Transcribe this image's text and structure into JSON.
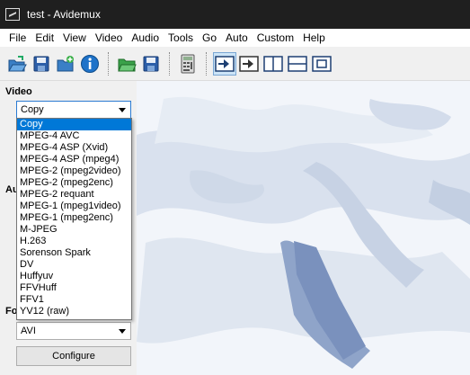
{
  "window": {
    "title": "test - Avidemux",
    "app_icon": "avidemux-app-icon"
  },
  "menubar": {
    "items": [
      "File",
      "Edit",
      "View",
      "Video",
      "Audio",
      "Tools",
      "Go",
      "Auto",
      "Custom",
      "Help"
    ]
  },
  "toolbar": {
    "icons": [
      "open-file-icon",
      "save-file-icon",
      "append-file-icon",
      "info-icon",
      "open-folder-icon",
      "save-project-icon",
      "calculator-icon",
      "play-filtered-icon",
      "next-keyframe-icon",
      "split-view-icon",
      "horizontal-view-icon",
      "fullscreen-icon"
    ]
  },
  "left_panel": {
    "video_label": "Video",
    "video_codec_value": "Copy",
    "audio_label_partial": "Au",
    "format_label_partial": "Fo",
    "format_value": "AVI",
    "configure_label": "Configure"
  },
  "video_codec_dropdown": {
    "options": [
      "Copy",
      "MPEG-4 AVC",
      "MPEG-4 ASP (Xvid)",
      "MPEG-4 ASP (mpeg4)",
      "MPEG-2 (mpeg2video)",
      "MPEG-2 (mpeg2enc)",
      "MPEG-2 requant",
      "MPEG-1 (mpeg1video)",
      "MPEG-1 (mpeg2enc)",
      "M-JPEG",
      "H.263",
      "Sorenson Spark",
      "DV",
      "Huffyuv",
      "FFVHuff",
      "FFV1",
      "YV12 (raw)"
    ],
    "selected_index": 0
  },
  "colors": {
    "titlebar": "#1f1f1f",
    "selection": "#0078d7",
    "preview_bg": "#f4f7fb"
  }
}
